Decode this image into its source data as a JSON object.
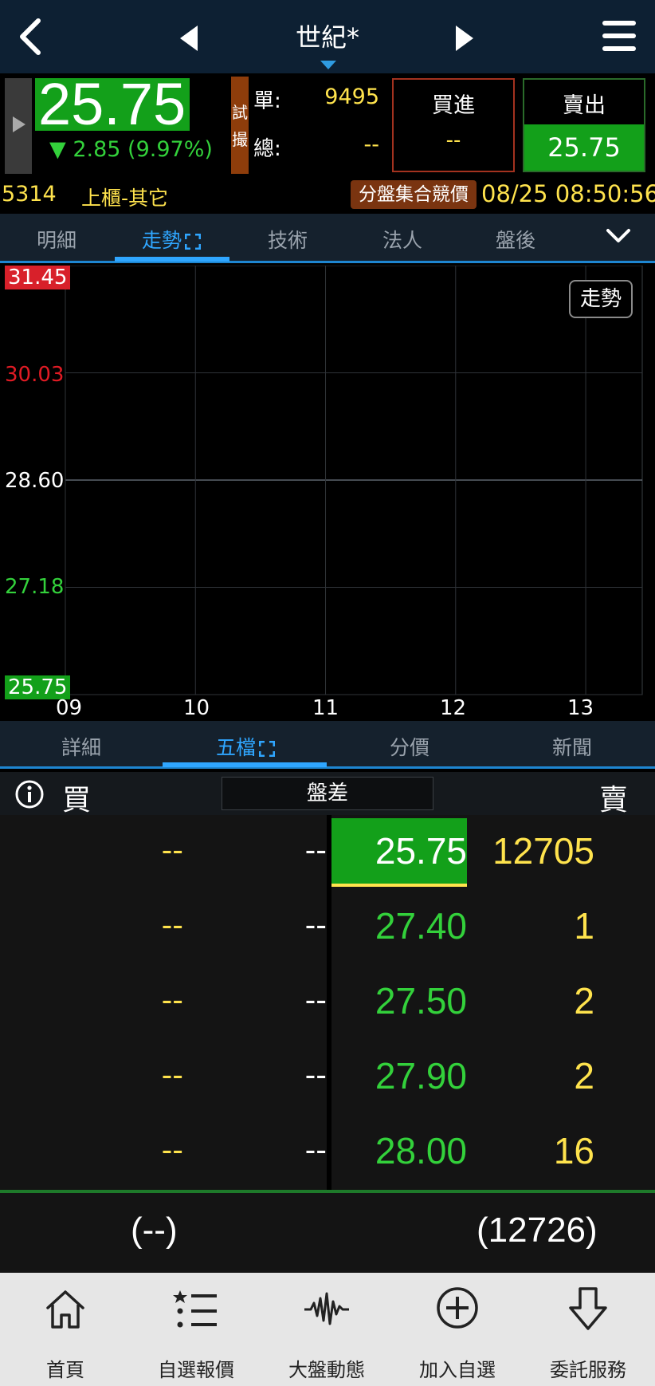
{
  "header": {
    "title": "世紀*"
  },
  "quote": {
    "price": "25.75",
    "change": "▼ 2.85 (9.97%)",
    "trial_label_1": "試",
    "trial_label_2": "撮",
    "single_label": "單:",
    "single_value": "9495",
    "total_label": "總:",
    "total_value": "--",
    "buy_label": "買進",
    "buy_value": "--",
    "sell_label": "賣出",
    "sell_value": "25.75",
    "code": "5314",
    "market": "上櫃-其它",
    "session_badge": "分盤集合競價",
    "datetime": "08/25 08:50:56"
  },
  "tabs_top": {
    "items": [
      "明細",
      "走勢",
      "技術",
      "法人",
      "盤後"
    ],
    "active_index": 1
  },
  "chart": {
    "trend_button": "走勢"
  },
  "chart_data": {
    "type": "line",
    "title": "",
    "xlabel": "",
    "ylabel": "",
    "x_ticks": [
      "09",
      "10",
      "11",
      "12",
      "13"
    ],
    "y_ticks": [
      "31.45",
      "30.03",
      "28.60",
      "27.18",
      "25.75"
    ],
    "ylim": [
      25.75,
      31.45
    ],
    "series": [],
    "grid": true,
    "colors": {
      "limit_up": "#e01b24",
      "up": "#e01b24",
      "reference": "#ffffff",
      "down": "#33d13b",
      "limit_down": "#13a01a"
    }
  },
  "tabs_bottom": {
    "items": [
      "詳細",
      "五檔",
      "分價",
      "新聞"
    ],
    "active_index": 1
  },
  "order_book": {
    "buy_label": "買",
    "spread_label": "盤差",
    "sell_label": "賣",
    "rows": [
      {
        "bid_vol": "--",
        "bid_px": "--",
        "ask_px": "25.75",
        "ask_vol": "12705"
      },
      {
        "bid_vol": "--",
        "bid_px": "--",
        "ask_px": "27.40",
        "ask_vol": "1"
      },
      {
        "bid_vol": "--",
        "bid_px": "--",
        "ask_px": "27.50",
        "ask_vol": "2"
      },
      {
        "bid_vol": "--",
        "bid_px": "--",
        "ask_px": "27.90",
        "ask_vol": "2"
      },
      {
        "bid_vol": "--",
        "bid_px": "--",
        "ask_px": "28.00",
        "ask_vol": "16"
      }
    ],
    "bid_total": "(--)",
    "ask_total": "(12726)"
  },
  "bottom_nav": {
    "items": [
      {
        "label": "首頁",
        "icon": "home-icon"
      },
      {
        "label": "自選報價",
        "icon": "star-list-icon"
      },
      {
        "label": "大盤動態",
        "icon": "pulse-icon"
      },
      {
        "label": "加入自選",
        "icon": "plus-circle-icon"
      },
      {
        "label": "委託服務",
        "icon": "down-arrow-icon"
      }
    ]
  },
  "colors": {
    "accent": "#2fa6ff",
    "up_red": "#e01b24",
    "down_green": "#33d13b",
    "limit_green": "#13a01a",
    "yellow": "#ffe34d",
    "nav_bg": "#0d2033"
  }
}
